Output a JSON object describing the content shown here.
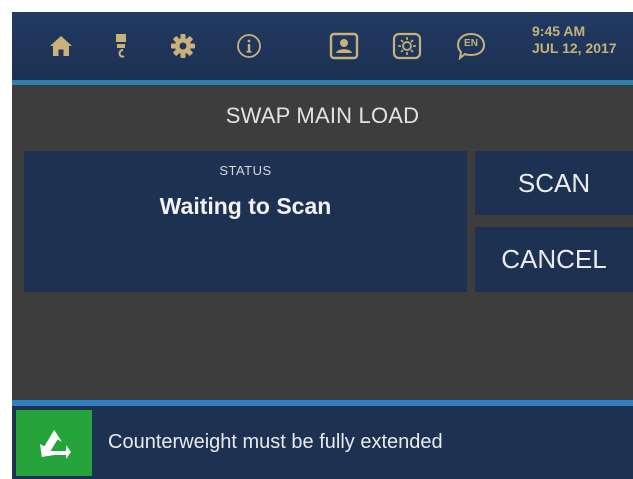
{
  "topbar": {
    "icons": [
      "home-icon",
      "test-tube-icon",
      "gear-icon",
      "info-icon",
      "operator-badge-icon",
      "brightness-icon",
      "language-icon"
    ],
    "language_code": "EN",
    "info_glyph": "i",
    "time": "9:45 AM",
    "date": "JUL 12, 2017"
  },
  "page": {
    "title": "SWAP MAIN LOAD"
  },
  "status": {
    "label": "STATUS",
    "value": "Waiting to Scan"
  },
  "buttons": {
    "scan": "SCAN",
    "cancel": "CANCEL"
  },
  "message": {
    "icon": "extend-arrow-icon",
    "text": "Counterweight must be fully extended"
  },
  "colors": {
    "panel": "#1d3152",
    "background": "#3d3d3d",
    "accent_blue": "#2f7fc2",
    "message_icon_green": "#24a43a",
    "clock_text": "#c8b27a"
  }
}
